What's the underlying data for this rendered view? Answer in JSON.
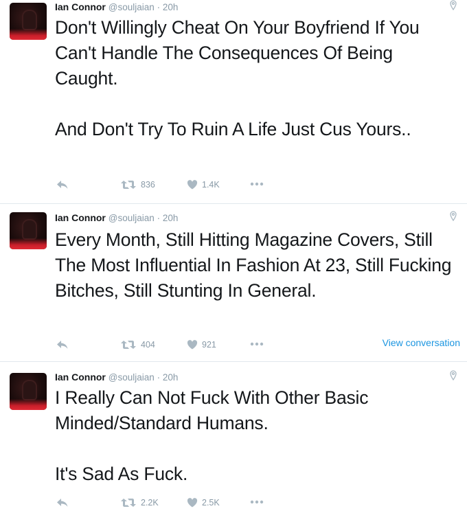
{
  "tweets": [
    {
      "name": "Ian Connor",
      "handle": "@souljaian",
      "time": "· 20h",
      "paragraphs": [
        "Don't Willingly Cheat On Your Boyfriend If You Can't Handle The Consequences Of Being Caught.",
        "And Don't Try To Ruin A Life Just Cus Yours.."
      ],
      "retweets": "836",
      "likes": "1.4K"
    },
    {
      "name": "Ian Connor",
      "handle": "@souljaian",
      "time": "· 20h",
      "paragraphs": [
        "Every Month, Still Hitting Magazine Covers, Still The Most Influential In Fashion At 23, Still Fucking Bitches, Still Stunting In General."
      ],
      "retweets": "404",
      "likes": "921",
      "view_conversation": "View conversation"
    },
    {
      "name": "Ian Connor",
      "handle": "@souljaian",
      "time": "· 20h",
      "paragraphs": [
        "I Really Can Not Fuck With Other Basic Minded/Standard Humans.",
        "It's Sad As Fuck."
      ],
      "retweets": "2.2K",
      "likes": "2.5K"
    }
  ],
  "icons": {
    "reply": "reply-icon",
    "retweet": "retweet-icon",
    "like": "heart-icon",
    "more": "more-icon",
    "location": "location-pin-icon"
  },
  "colors": {
    "text": "#14171a",
    "muted": "#8899a6",
    "link": "#1b95e0",
    "divider": "#e1e8ed"
  }
}
